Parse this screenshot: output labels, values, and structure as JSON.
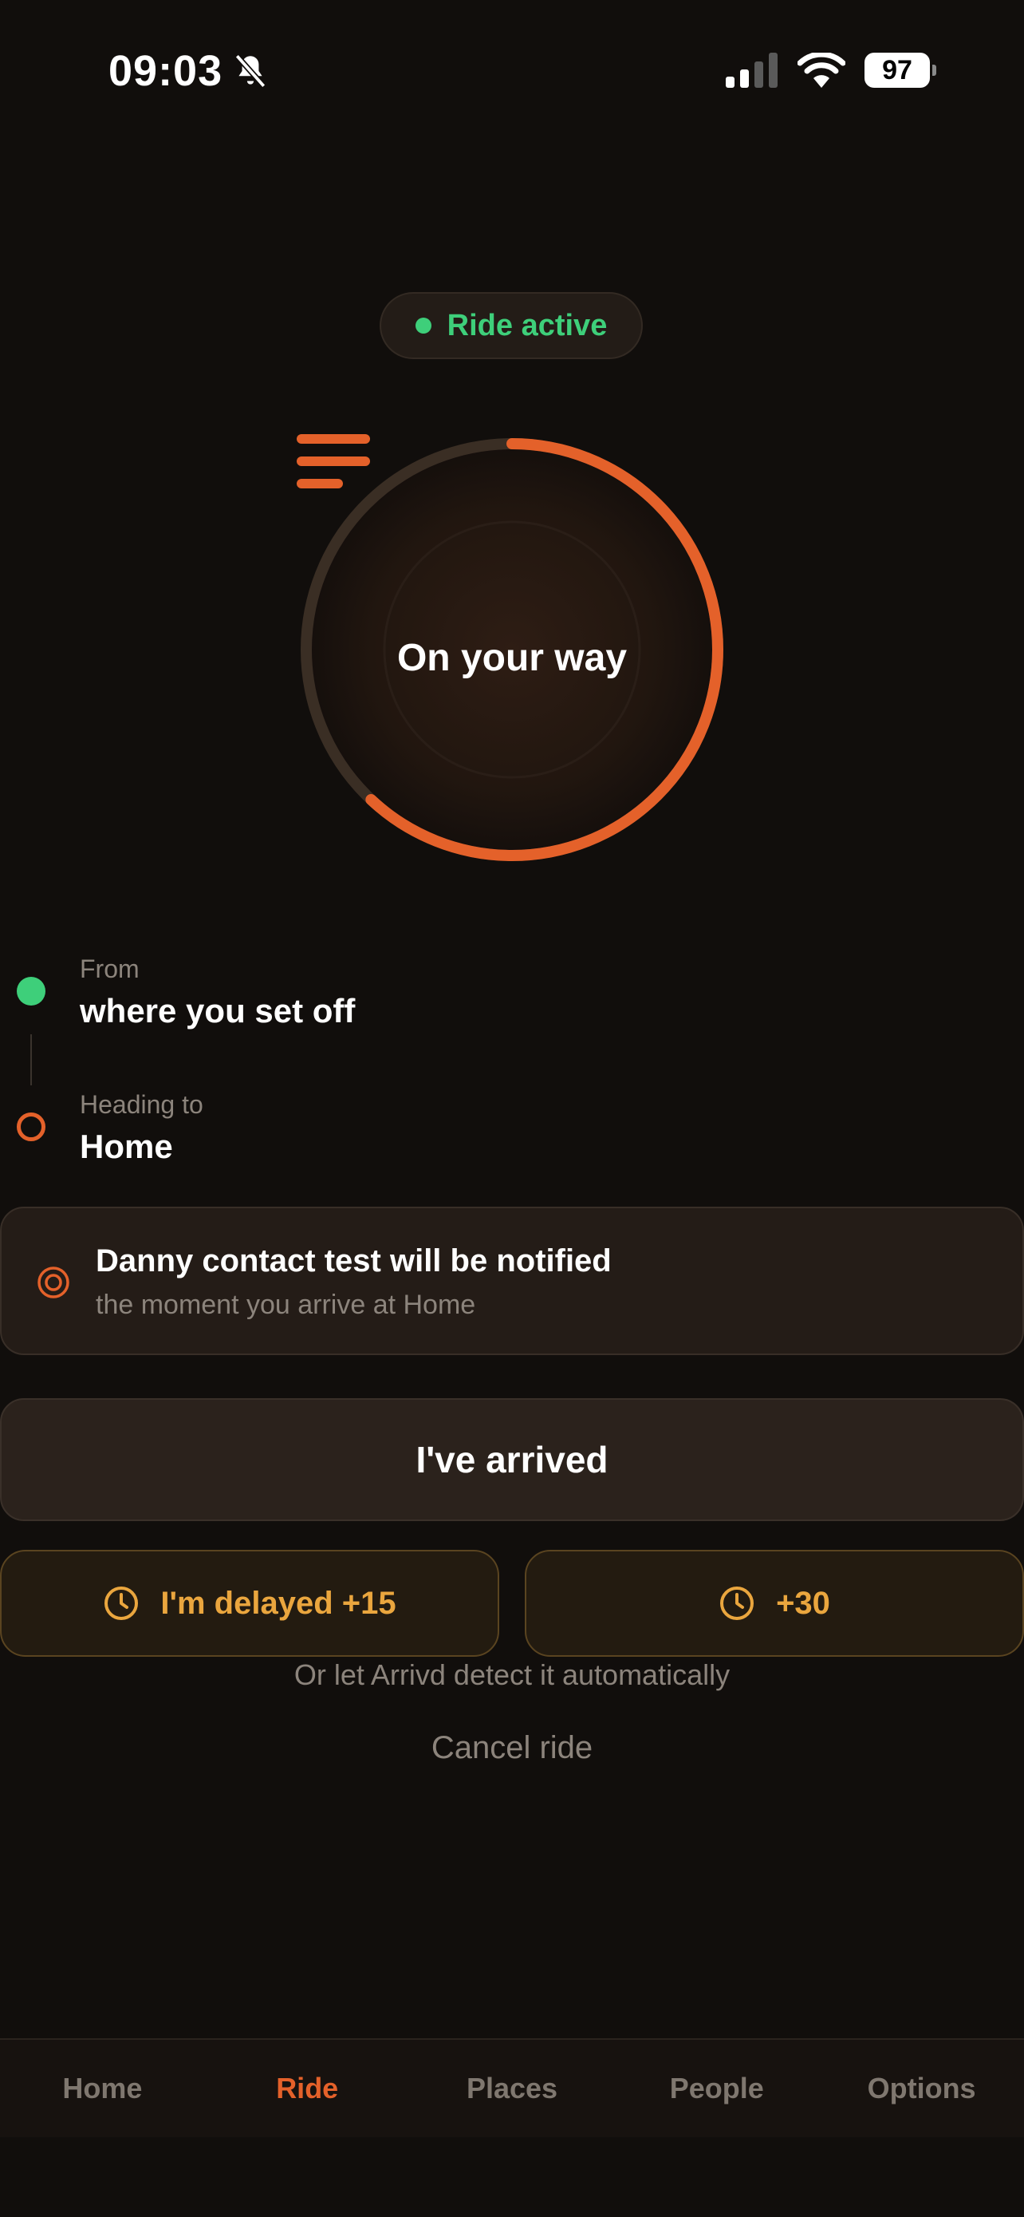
{
  "status_bar": {
    "time": "09:03",
    "battery": "97",
    "mute_icon": "bell-slash-icon",
    "signal_icon": "cellular-signal-icon",
    "wifi_icon": "wifi-icon"
  },
  "ride_status": {
    "label": "Ride active",
    "color": "#3ecf7a"
  },
  "progress": {
    "label": "On your way",
    "icon": "lines-icon",
    "fraction": 0.62,
    "accent": "#e4612a"
  },
  "route": {
    "from_label": "From",
    "from_value": "where you set off",
    "to_label": "Heading to",
    "to_value": "Home"
  },
  "notify": {
    "title": "Danny contact test will be notified",
    "subtitle": "the moment you arrive at Home",
    "icon": "target-icon"
  },
  "actions": {
    "arrived_label": "I've arrived",
    "delay_15_label": "I'm delayed +15",
    "delay_30_label": "+30",
    "auto_detect_text": "Or let Arrivd detect it automatically",
    "cancel_label": "Cancel ride",
    "delay_color": "#eaa63e"
  },
  "nav": {
    "items": [
      {
        "label": "Home"
      },
      {
        "label": "Ride",
        "active": true
      },
      {
        "label": "Places"
      },
      {
        "label": "People"
      },
      {
        "label": "Options"
      }
    ]
  }
}
